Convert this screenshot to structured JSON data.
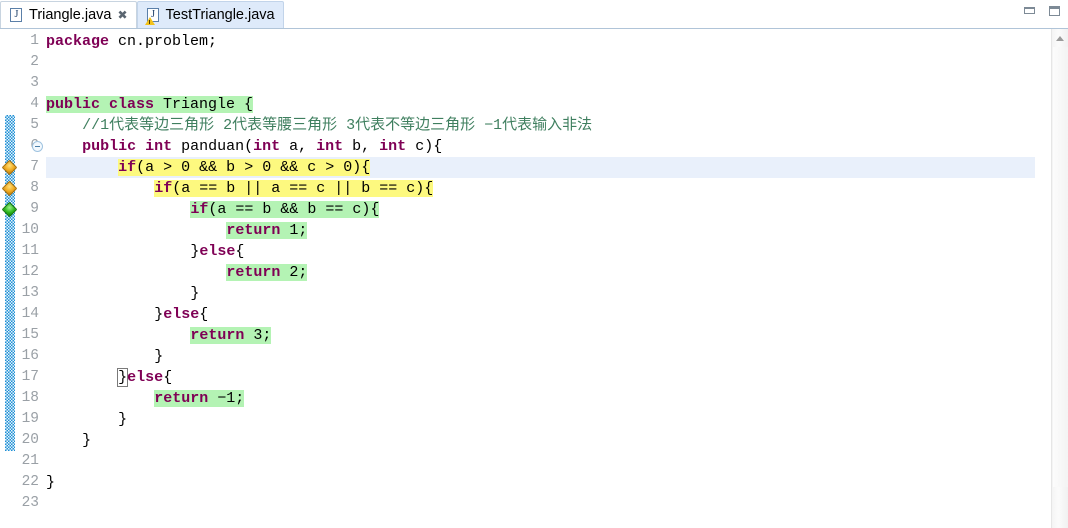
{
  "window": {
    "minimize_label": "Minimize",
    "maximize_label": "Maximize"
  },
  "tabs": [
    {
      "label": "Triangle.java",
      "icon": "java-file-icon",
      "active": true,
      "close": "✖",
      "has_warning": false
    },
    {
      "label": "TestTriangle.java",
      "icon": "java-file-warning-icon",
      "active": false,
      "close": "",
      "has_warning": true
    }
  ],
  "editor": {
    "current_line": 7,
    "fold_marker_line": 6,
    "change_bar": {
      "from_line": 5,
      "to_line": 20
    },
    "markers": [
      {
        "line": 7,
        "type": "breakpoint-orange-diamond"
      },
      {
        "line": 8,
        "type": "breakpoint-orange-diamond"
      },
      {
        "line": 9,
        "type": "breakpoint-green-diamond"
      }
    ],
    "line_numbers": [
      "1",
      "2",
      "3",
      "4",
      "5",
      "6",
      "7",
      "8",
      "9",
      "10",
      "11",
      "12",
      "13",
      "14",
      "15",
      "16",
      "17",
      "18",
      "19",
      "20",
      "21",
      "22",
      "23"
    ],
    "lines": [
      {
        "n": 1,
        "indent": 0,
        "highlight": "none",
        "tokens": [
          {
            "t": "package",
            "c": "kw"
          },
          {
            "t": " cn.problem;",
            "c": "plain"
          }
        ]
      },
      {
        "n": 2,
        "indent": 0,
        "highlight": "none",
        "tokens": []
      },
      {
        "n": 3,
        "indent": 0,
        "highlight": "none",
        "tokens": []
      },
      {
        "n": 4,
        "indent": 0,
        "highlight": "green",
        "tokens": [
          {
            "t": "public class",
            "c": "kw"
          },
          {
            "t": " Triangle {",
            "c": "plain"
          }
        ]
      },
      {
        "n": 5,
        "indent": 4,
        "highlight": "none",
        "tokens": [
          {
            "t": "//1代表等边三角形 2代表等腰三角形 3代表不等边三角形 −1代表输入非法",
            "c": "cmt"
          }
        ]
      },
      {
        "n": 6,
        "indent": 4,
        "highlight": "none",
        "tokens": [
          {
            "t": "public int",
            "c": "kw"
          },
          {
            "t": " panduan(",
            "c": "plain"
          },
          {
            "t": "int",
            "c": "kw"
          },
          {
            "t": " a, ",
            "c": "plain"
          },
          {
            "t": "int",
            "c": "kw"
          },
          {
            "t": " b, ",
            "c": "plain"
          },
          {
            "t": "int",
            "c": "kw"
          },
          {
            "t": " c){",
            "c": "plain"
          }
        ]
      },
      {
        "n": 7,
        "indent": 8,
        "highlight": "yellow",
        "tokens": [
          {
            "t": "if",
            "c": "kw"
          },
          {
            "t": "(a > 0 && b > 0 && c > 0){",
            "c": "plain"
          }
        ]
      },
      {
        "n": 8,
        "indent": 12,
        "highlight": "yellow",
        "tokens": [
          {
            "t": "if",
            "c": "kw"
          },
          {
            "t": "(a == b || a == c || b == c){",
            "c": "plain"
          }
        ]
      },
      {
        "n": 9,
        "indent": 16,
        "highlight": "green",
        "tokens": [
          {
            "t": "if",
            "c": "kw"
          },
          {
            "t": "(a == b && b == c){",
            "c": "plain"
          }
        ]
      },
      {
        "n": 10,
        "indent": 20,
        "highlight": "green",
        "tokens": [
          {
            "t": "return",
            "c": "kw"
          },
          {
            "t": " 1;",
            "c": "plain"
          }
        ]
      },
      {
        "n": 11,
        "indent": 16,
        "highlight": "none",
        "tokens": [
          {
            "t": "}",
            "c": "plain"
          },
          {
            "t": "else",
            "c": "kw"
          },
          {
            "t": "{",
            "c": "plain"
          }
        ]
      },
      {
        "n": 12,
        "indent": 20,
        "highlight": "green",
        "tokens": [
          {
            "t": "return",
            "c": "kw"
          },
          {
            "t": " 2;",
            "c": "plain"
          }
        ]
      },
      {
        "n": 13,
        "indent": 16,
        "highlight": "none",
        "tokens": [
          {
            "t": "}",
            "c": "plain"
          }
        ]
      },
      {
        "n": 14,
        "indent": 12,
        "highlight": "none",
        "tokens": [
          {
            "t": "}",
            "c": "plain"
          },
          {
            "t": "else",
            "c": "kw"
          },
          {
            "t": "{",
            "c": "plain"
          }
        ]
      },
      {
        "n": 15,
        "indent": 16,
        "highlight": "green",
        "tokens": [
          {
            "t": "return",
            "c": "kw"
          },
          {
            "t": " 3;",
            "c": "plain"
          }
        ]
      },
      {
        "n": 16,
        "indent": 12,
        "highlight": "none",
        "tokens": [
          {
            "t": "}",
            "c": "plain"
          }
        ]
      },
      {
        "n": 17,
        "indent": 8,
        "highlight": "none",
        "match_first": true,
        "tokens": [
          {
            "t": "}",
            "c": "plain"
          },
          {
            "t": "else",
            "c": "kw"
          },
          {
            "t": "{",
            "c": "plain"
          }
        ]
      },
      {
        "n": 18,
        "indent": 12,
        "highlight": "green",
        "tokens": [
          {
            "t": "return",
            "c": "kw"
          },
          {
            "t": " −1;",
            "c": "plain"
          }
        ]
      },
      {
        "n": 19,
        "indent": 8,
        "highlight": "none",
        "tokens": [
          {
            "t": "}",
            "c": "plain"
          }
        ]
      },
      {
        "n": 20,
        "indent": 4,
        "highlight": "none",
        "tokens": [
          {
            "t": "}",
            "c": "plain"
          }
        ]
      },
      {
        "n": 21,
        "indent": 0,
        "highlight": "none",
        "tokens": []
      },
      {
        "n": 22,
        "indent": 0,
        "highlight": "none",
        "tokens": [
          {
            "t": "}",
            "c": "plain"
          }
        ]
      },
      {
        "n": 23,
        "indent": 0,
        "highlight": "none",
        "tokens": []
      }
    ]
  },
  "scrollbar": {
    "up_arrow": "scroll-up-arrow",
    "thumb": "vertical-scroll-thumb"
  },
  "colors": {
    "keyword": "#7F0055",
    "comment": "#3F7F5F",
    "highlight_yellow": "#FDF97F",
    "highlight_green": "#B4F3B4",
    "current_line": "#E9F0FB",
    "change_bar": "#1E8FD5",
    "tab_inactive_bg": "#DEEAFA"
  }
}
